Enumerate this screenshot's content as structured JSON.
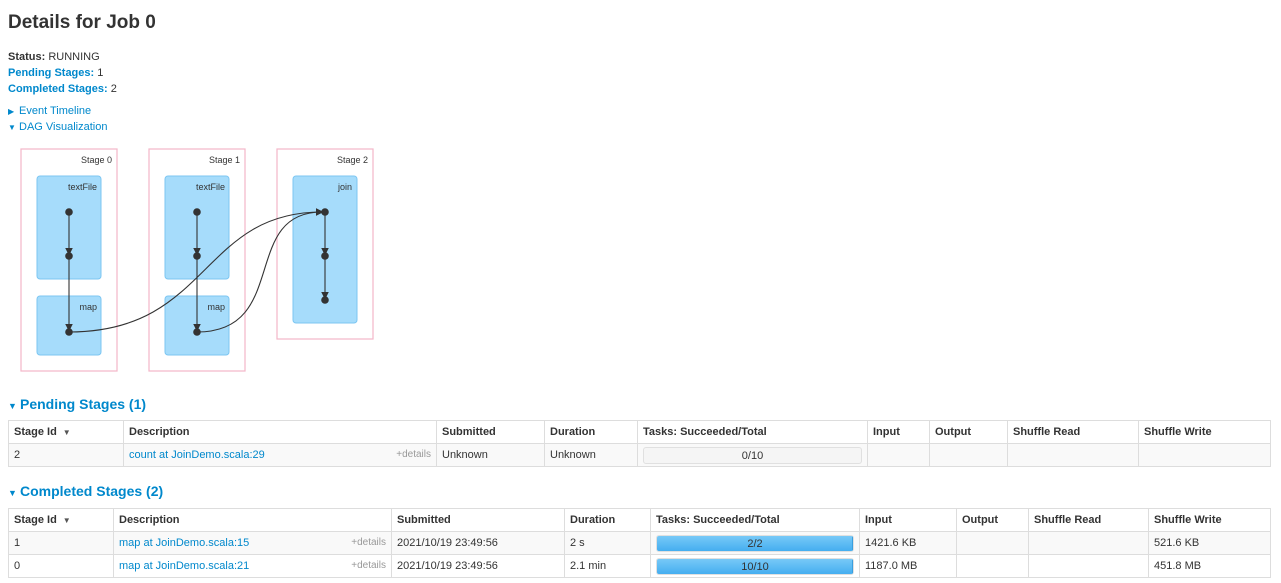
{
  "page": {
    "title": "Details for Job 0"
  },
  "summary": {
    "status_label": "Status:",
    "status_value": "RUNNING",
    "pending_label": "Pending Stages:",
    "pending_value": "1",
    "completed_label": "Completed Stages:",
    "completed_value": "2"
  },
  "toggles": {
    "event_timeline": "Event Timeline",
    "dag_visualization": "DAG Visualization"
  },
  "dag": {
    "stages": [
      {
        "label": "Stage 0",
        "clusters": [
          "textFile",
          "map"
        ]
      },
      {
        "label": "Stage 1",
        "clusters": [
          "textFile",
          "map"
        ]
      },
      {
        "label": "Stage 2",
        "clusters": [
          "join"
        ]
      }
    ],
    "colors": {
      "stage_border": "#f4b6c8",
      "cluster_fill": "#a6dcfb",
      "cluster_border": "#7cc6f2",
      "edge": "#333333"
    }
  },
  "pending": {
    "title": "Pending Stages (1)",
    "headers": [
      "Stage Id",
      "Description",
      "Submitted",
      "Duration",
      "Tasks: Succeeded/Total",
      "Input",
      "Output",
      "Shuffle Read",
      "Shuffle Write"
    ],
    "rows": [
      {
        "id": "2",
        "description": "count at JoinDemo.scala:29",
        "details": "+details",
        "submitted": "Unknown",
        "duration": "Unknown",
        "tasks": "0/10",
        "progress": 0,
        "input": "",
        "output": "",
        "shuffle_read": "",
        "shuffle_write": ""
      }
    ]
  },
  "completed": {
    "title": "Completed Stages (2)",
    "headers": [
      "Stage Id",
      "Description",
      "Submitted",
      "Duration",
      "Tasks: Succeeded/Total",
      "Input",
      "Output",
      "Shuffle Read",
      "Shuffle Write"
    ],
    "rows": [
      {
        "id": "1",
        "description": "map at JoinDemo.scala:15",
        "details": "+details",
        "submitted": "2021/10/19 23:49:56",
        "duration": "2 s",
        "tasks": "2/2",
        "progress": 1,
        "input": "1421.6 KB",
        "output": "",
        "shuffle_read": "",
        "shuffle_write": "521.6 KB"
      },
      {
        "id": "0",
        "description": "map at JoinDemo.scala:21",
        "details": "+details",
        "submitted": "2021/10/19 23:49:56",
        "duration": "2.1 min",
        "tasks": "10/10",
        "progress": 1,
        "input": "1187.0 MB",
        "output": "",
        "shuffle_read": "",
        "shuffle_write": "451.8 MB"
      }
    ]
  }
}
